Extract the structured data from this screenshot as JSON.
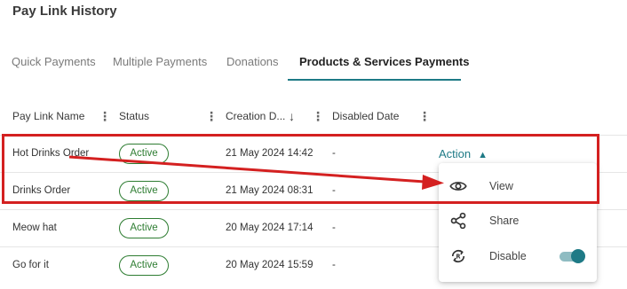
{
  "page": {
    "title": "Pay Link History"
  },
  "tabs": [
    {
      "label": "Quick Payments"
    },
    {
      "label": "Multiple Payments"
    },
    {
      "label": "Donations"
    },
    {
      "label": "Products & Services Payments",
      "active": true
    }
  ],
  "table": {
    "headers": {
      "name": "Pay Link Name",
      "status": "Status",
      "creation": "Creation D...",
      "disabled": "Disabled Date"
    },
    "sort": "descending",
    "rows": [
      {
        "name": "Hot Drinks Order",
        "status": "Active",
        "created": "21 May 2024 14:42",
        "disabled": "-"
      },
      {
        "name": "Drinks Order",
        "status": "Active",
        "created": "21 May 2024 08:31",
        "disabled": "-"
      },
      {
        "name": "Meow hat",
        "status": "Active",
        "created": "20 May 2024 17:14",
        "disabled": "-"
      },
      {
        "name": "Go for it",
        "status": "Active",
        "created": "20 May 2024 15:59",
        "disabled": "-"
      }
    ]
  },
  "action": {
    "label": "Action",
    "icon": "chevron-up-icon",
    "menu": [
      {
        "label": "View",
        "icon": "eye-icon"
      },
      {
        "label": "Share",
        "icon": "share-icon"
      },
      {
        "label": "Disable",
        "icon": "disable-link-icon",
        "toggle_on": true
      }
    ]
  },
  "colors": {
    "accent": "#1e7a86",
    "active_badge": "#2e7d32",
    "annotation": "#d42020"
  }
}
